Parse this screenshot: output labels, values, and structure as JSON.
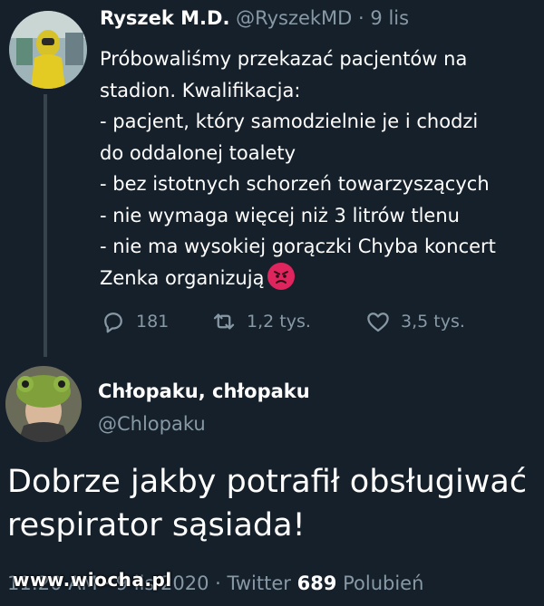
{
  "tweet1": {
    "author_name": "Ryszek M.D.",
    "handle": "@RyszekMD",
    "separator": "·",
    "date": "9 lis",
    "lines": [
      "Próbowaliśmy przekazać pacjentów na",
      "stadion. Kwalifikacja:",
      "- pacjent, który samodzielnie je i chodzi",
      "do oddalonej toalety",
      "- bez istotnych schorzeń towarzyszących",
      "- nie wymaga więcej niż 3 litrów tlenu",
      "- nie ma wysokiej gorączki Chyba koncert",
      "Zenka organizują"
    ],
    "replies": "181",
    "retweets": "1,2 tys.",
    "likes": "3,5 tys.",
    "icons": {
      "reply": "reply-icon",
      "retweet": "retweet-icon",
      "like": "heart-icon",
      "emoji": "angry-face-emoji-icon"
    }
  },
  "tweet2": {
    "author_name": "Chłopaku, chłopaku",
    "handle": "@Chlopaku",
    "lines": [
      "Dobrze jakby potrafił obsługiwać",
      "respirator sąsiada!"
    ],
    "footer_time": "11:20 AM · 9 lis 2020 · Twitter",
    "likes_count": "689",
    "likes_label": "Polubień"
  },
  "watermark": "www.wiocha.pl",
  "colors": {
    "background": "#15202b",
    "muted": "#8899a6",
    "text": "#ffffff",
    "emoji": "#e0245e"
  }
}
